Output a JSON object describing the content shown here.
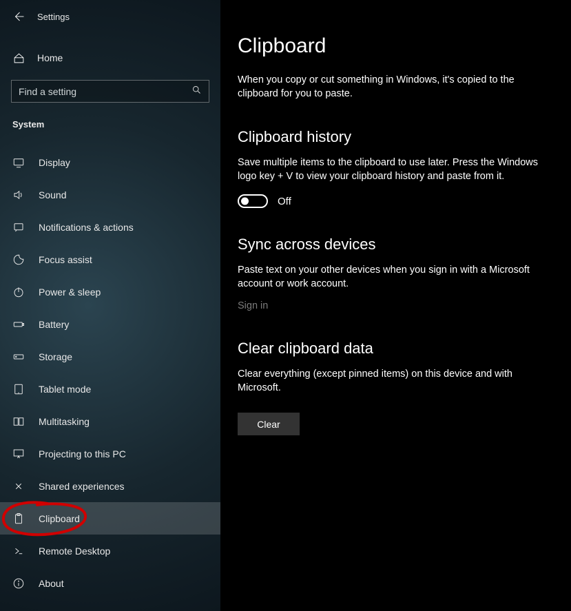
{
  "window": {
    "title": "Settings"
  },
  "home": {
    "label": "Home"
  },
  "search": {
    "placeholder": "Find a setting"
  },
  "group": {
    "label": "System"
  },
  "nav": {
    "items": [
      {
        "id": "display",
        "label": "Display"
      },
      {
        "id": "sound",
        "label": "Sound"
      },
      {
        "id": "notifications",
        "label": "Notifications & actions"
      },
      {
        "id": "focus-assist",
        "label": "Focus assist"
      },
      {
        "id": "power-sleep",
        "label": "Power & sleep"
      },
      {
        "id": "battery",
        "label": "Battery"
      },
      {
        "id": "storage",
        "label": "Storage"
      },
      {
        "id": "tablet-mode",
        "label": "Tablet mode"
      },
      {
        "id": "multitasking",
        "label": "Multitasking"
      },
      {
        "id": "projecting",
        "label": "Projecting to this PC"
      },
      {
        "id": "shared-experiences",
        "label": "Shared experiences"
      },
      {
        "id": "clipboard",
        "label": "Clipboard"
      },
      {
        "id": "remote-desktop",
        "label": "Remote Desktop"
      },
      {
        "id": "about",
        "label": "About"
      }
    ]
  },
  "content": {
    "title": "Clipboard",
    "intro": "When you copy or cut something in Windows, it's copied to the clipboard for you to paste.",
    "history": {
      "heading": "Clipboard history",
      "body": "Save multiple items to the clipboard to use later. Press the Windows logo key + V to view your clipboard history and paste from it.",
      "toggle_state": "Off"
    },
    "sync": {
      "heading": "Sync across devices",
      "body": "Paste text on your other devices when you sign in with a Microsoft account or work account.",
      "link": "Sign in"
    },
    "clear": {
      "heading": "Clear clipboard data",
      "body": "Clear everything (except pinned items) on this device and with Microsoft.",
      "button": "Clear"
    }
  }
}
